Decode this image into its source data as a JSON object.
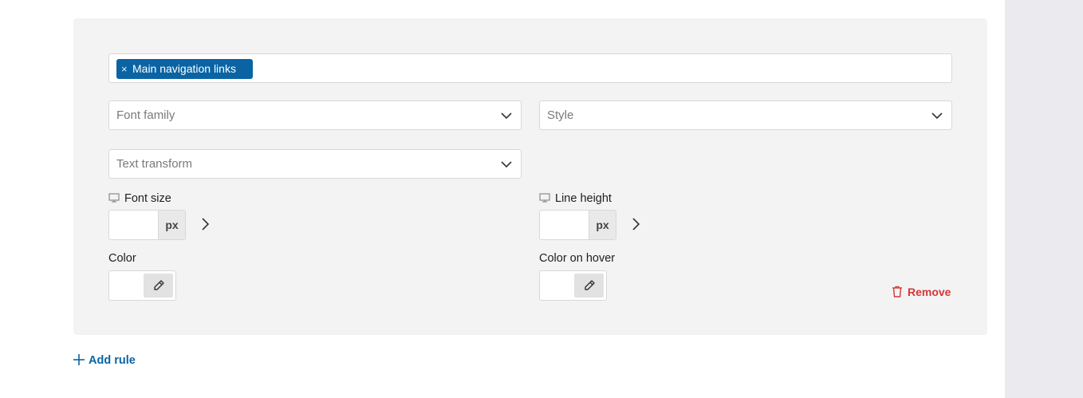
{
  "rule": {
    "selector_token": "Main navigation links",
    "token_remove_glyph": "×",
    "font_family": {
      "placeholder": "Font family"
    },
    "style": {
      "placeholder": "Style"
    },
    "text_transform": {
      "placeholder": "Text transform"
    },
    "font_size": {
      "label": "Font size",
      "value": "",
      "unit": "px"
    },
    "line_height": {
      "label": "Line height",
      "value": "",
      "unit": "px"
    },
    "color": {
      "label": "Color"
    },
    "color_hover": {
      "label": "Color on hover"
    },
    "remove_label": "Remove"
  },
  "add_rule_label": "Add rule",
  "colors": {
    "accent": "#0a64a4",
    "danger": "#d63638",
    "card_bg": "#f3f3f3",
    "gutter_bg": "#ebebef"
  },
  "icons": [
    "close-icon",
    "chevron-down-icon",
    "monitor-icon",
    "chevron-right-icon",
    "eyedropper-icon",
    "trash-icon",
    "plus-icon"
  ]
}
